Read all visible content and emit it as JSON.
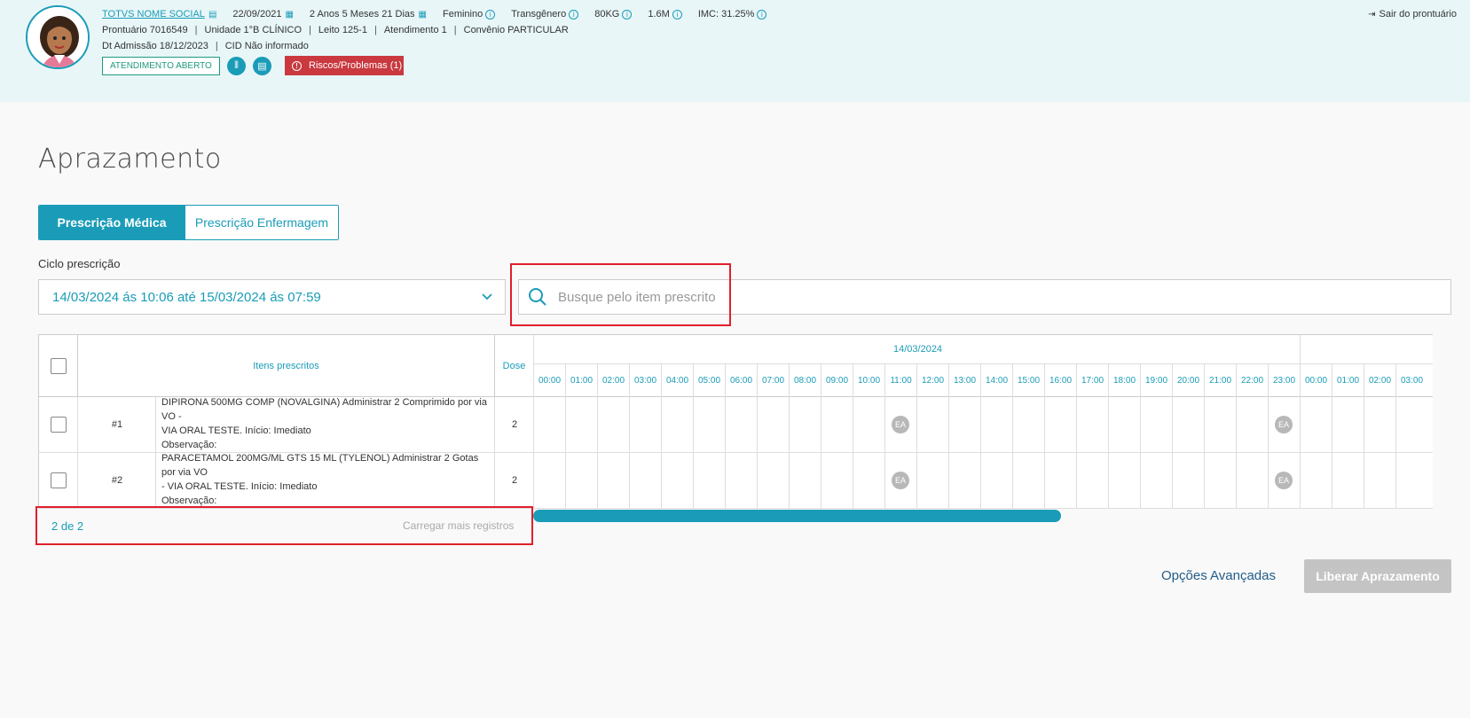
{
  "patient": {
    "name": "TOTVS NOME SOCIAL",
    "birth_date": "22/09/2021",
    "age": "2 Anos 5 Meses 21 Dias",
    "gender": "Feminino",
    "identity": "Transgênero",
    "weight": "80KG",
    "height": "1.6M",
    "imc": "IMC: 31.25%",
    "prontuario": "Prontuário 7016549",
    "unidade": "Unidade 1°B CLÍNICO",
    "leito": "Leito 125-1",
    "atendimento": "Atendimento 1",
    "convenio": "Convênio PARTICULAR",
    "admissao": "Dt Admissão 18/12/2023",
    "cid": "CID Não informado",
    "status": "ATENDIMENTO ABERTO",
    "riscos": "Riscos/Problemas (1)",
    "sair": "Sair do prontuário"
  },
  "page": {
    "title": "Aprazamento"
  },
  "tabs": [
    {
      "label": "Prescrição Médica",
      "active": true
    },
    {
      "label": "Prescrição Enfermagem",
      "active": false
    }
  ],
  "ciclo": {
    "label": "Ciclo prescrição",
    "value": "14/03/2024 ás 10:06 até 15/03/2024 ás 07:59"
  },
  "search": {
    "placeholder": "Busque pelo item prescrito"
  },
  "table": {
    "header_items": "Itens prescritos",
    "header_dose": "Dose",
    "dates": [
      "14/03/2024"
    ],
    "hours": [
      "00:00",
      "01:00",
      "02:00",
      "03:00",
      "04:00",
      "05:00",
      "06:00",
      "07:00",
      "08:00",
      "09:00",
      "10:00",
      "11:00",
      "12:00",
      "13:00",
      "14:00",
      "15:00",
      "16:00",
      "17:00",
      "18:00",
      "19:00",
      "20:00",
      "21:00",
      "22:00",
      "23:00",
      "00:00",
      "01:00",
      "02:00",
      "03:00"
    ],
    "rows": [
      {
        "num": "#1",
        "desc_line1": "DIPIRONA 500MG COMP (NOVALGINA) Administrar 2 Comprimido por via VO -",
        "desc_line2": "VIA ORAL TESTE. Início: Imediato",
        "obs": "Observação:",
        "dose": "2",
        "scheduled": [
          "11:00",
          "23:00"
        ],
        "mark": "EA"
      },
      {
        "num": "#2",
        "desc_line1": "PARACETAMOL 200MG/ML GTS 15 ML (TYLENOL) Administrar 2 Gotas por via VO",
        "desc_line2": "- VIA ORAL TESTE. Início: Imediato",
        "obs": "Observação:",
        "dose": "2",
        "scheduled": [
          "11:00",
          "23:00"
        ],
        "mark": "EA"
      }
    ]
  },
  "footer": {
    "count": "2 de 2",
    "load_more": "Carregar mais registros"
  },
  "actions": {
    "advanced": "Opções Avançadas",
    "release": "Liberar Aprazamento"
  },
  "colors": {
    "accent": "#1a9cb8",
    "danger": "#c9393f",
    "status_green": "#1f9a7e",
    "header_bg": "#e8f6f8"
  }
}
